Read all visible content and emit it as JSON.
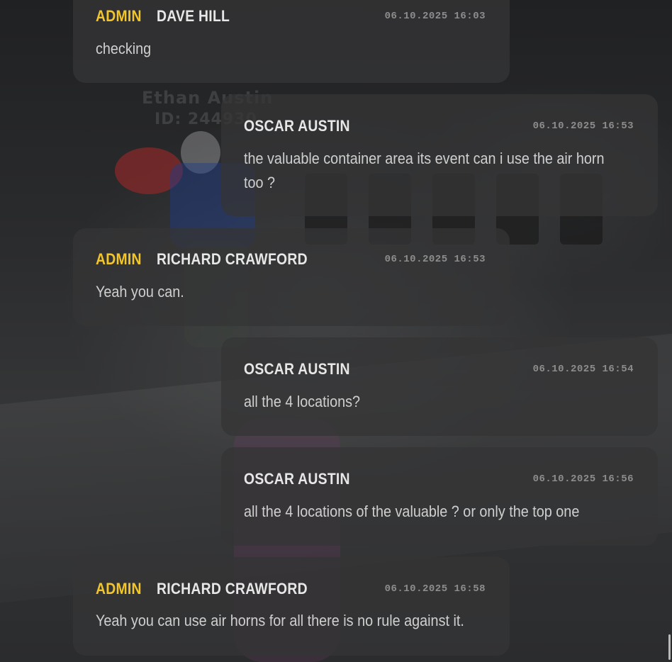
{
  "messages": [
    {
      "role": "ADMIN",
      "name": "DAVE HILL",
      "timestamp": "06.10.2025 16:03",
      "text": "checking"
    },
    {
      "role": "",
      "name": "OSCAR AUSTIN",
      "timestamp": "06.10.2025 16:53",
      "text_line1": "the valuable container area its event can i use the air horn",
      "text_line2": "too ?"
    },
    {
      "role": "ADMIN",
      "name": "RICHARD CRAWFORD",
      "timestamp": "06.10.2025 16:53",
      "text": "Yeah you can."
    },
    {
      "role": "",
      "name": "OSCAR AUSTIN",
      "timestamp": "06.10.2025 16:54",
      "text": "all the 4 locations?"
    },
    {
      "role": "",
      "name": "OSCAR AUSTIN",
      "timestamp": "06.10.2025 16:56",
      "text": "all the 4 locations of the valuable ? or only the top one"
    },
    {
      "role": "ADMIN",
      "name": "RICHARD CRAWFORD",
      "timestamp": "06.10.2025 16:58",
      "text": "Yeah you can use air horns for all there is no rule against it."
    }
  ],
  "background": {
    "player_name": "Ethan Austin",
    "player_id": "ID: 244930"
  },
  "colors": {
    "admin_role": "#f2c62a",
    "name": "#e7e7e7",
    "timestamp": "#8d8d8d",
    "message_text": "#cfcfcf",
    "bubble": "#343436"
  }
}
